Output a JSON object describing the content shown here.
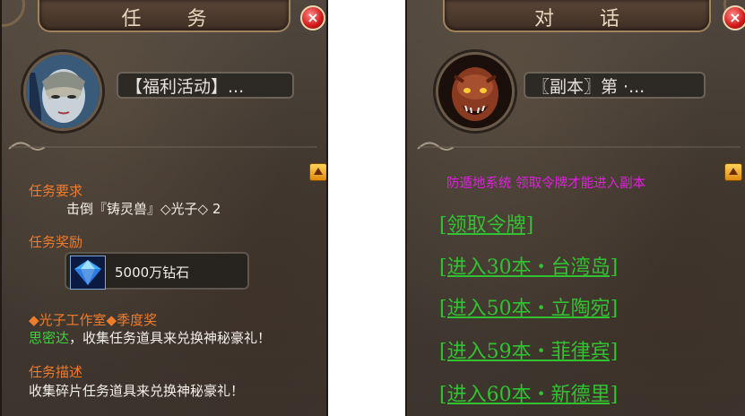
{
  "left_panel": {
    "title": "任 务",
    "close_glyph": "×",
    "npc_name": "【福利活动】...",
    "requirement_label": "任务要求",
    "requirement_text": "击倒『铸灵兽』◇光子◇ 2",
    "reward_label": "任务奖励",
    "reward_item": "5000万钻石",
    "promo_line": "◆光子工作室◆季度奖",
    "promo_name": "思密达",
    "promo_text": "，收集任务道具来兑换神秘豪礼！",
    "desc_label": "任务描述",
    "desc_text": "收集碎片任务道具来兑换神秘豪礼！"
  },
  "right_panel": {
    "title": "对 话",
    "close_glyph": "×",
    "npc_name": "〖副本〗第 ·...",
    "notice": "防遁地系统 领取令牌才能进入副本",
    "options": [
      "[领取令牌]",
      "[进入30本・台湾岛]",
      "[进入50本・立陶宛]",
      "[进入59本・菲律宾]",
      "[进入60本・新德里]"
    ]
  },
  "colors": {
    "label_orange": "#f07b2a",
    "name_green": "#3ed13e",
    "notice_magenta": "#e020e0",
    "option_green": "#31c231"
  },
  "icons": [
    "close-icon",
    "scroll-up-icon",
    "diamond-gem-icon",
    "masked-woman-avatar",
    "demon-avatar"
  ]
}
